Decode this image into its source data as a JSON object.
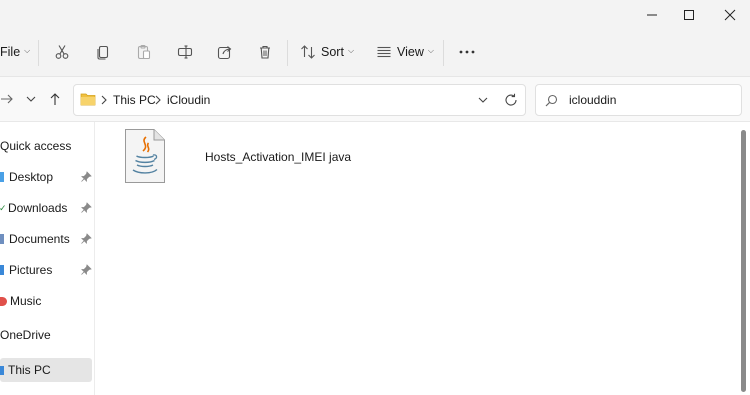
{
  "toolbar": {
    "file_label": "File",
    "sort_label": "Sort",
    "view_label": "View"
  },
  "address": {
    "crumbs": [
      "This PC",
      "iCloudin"
    ]
  },
  "search": {
    "value": "iclouddin"
  },
  "sidebar": {
    "items": [
      {
        "label": "Quick access"
      },
      {
        "label": "Desktop",
        "pinned": true
      },
      {
        "label": "Downloads",
        "pinned": true
      },
      {
        "label": "Documents",
        "pinned": true
      },
      {
        "label": "Pictures",
        "pinned": true
      },
      {
        "label": "Music"
      },
      {
        "label": "OneDrive"
      },
      {
        "label": "This PC",
        "selected": true
      }
    ]
  },
  "files": [
    {
      "name": "Hosts_Activation_IMEI java",
      "icon": "java-file-icon"
    }
  ],
  "colors": {
    "folder": "#f0c040",
    "selected_bg": "#e5e5e5",
    "java_orange": "#e76f00",
    "java_blue": "#5382a1"
  }
}
